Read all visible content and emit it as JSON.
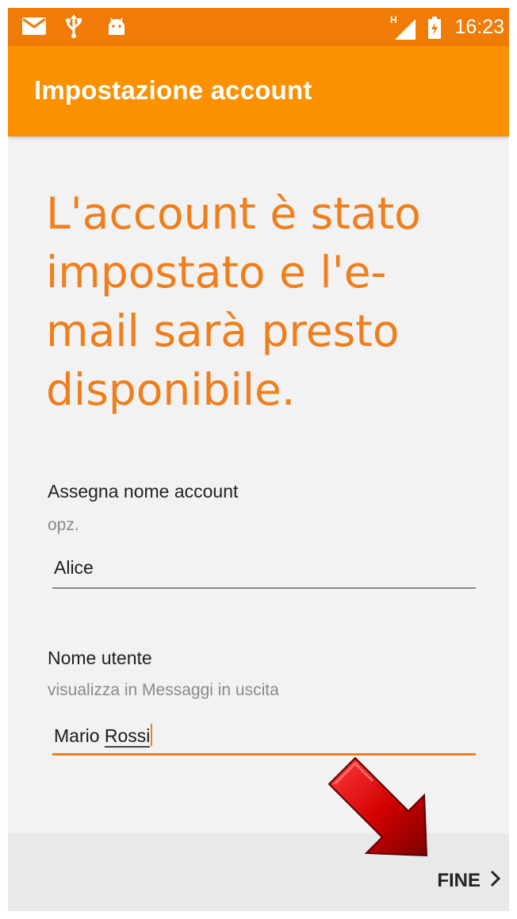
{
  "status_bar": {
    "icons": [
      "mail-icon",
      "usb-icon",
      "android-icon",
      "signal-icon",
      "battery-icon"
    ],
    "network_label": "H",
    "time": "16:23"
  },
  "app_bar": {
    "title": "Impostazione account"
  },
  "main": {
    "headline_lines": [
      "L'account è stato",
      "impostato e l'e-",
      "mail sarà presto",
      "disponibile."
    ],
    "account_name": {
      "label": "Assegna nome account",
      "hint": "opz.",
      "value": "Alice"
    },
    "user_name": {
      "label": "Nome utente",
      "hint": "visualizza in Messaggi in uscita",
      "value_first": "Mario",
      "value_last": "Rossi"
    }
  },
  "bottom_bar": {
    "next_label": "FINE",
    "next_icon": "chevron-right-icon"
  },
  "overlay": {
    "arrow_icon": "red-arrow-icon"
  },
  "colors": {
    "status_bar": "#f07c07",
    "app_bar": "#fb9001",
    "accent": "#ef7e1c",
    "background": "#f2f2f2"
  }
}
